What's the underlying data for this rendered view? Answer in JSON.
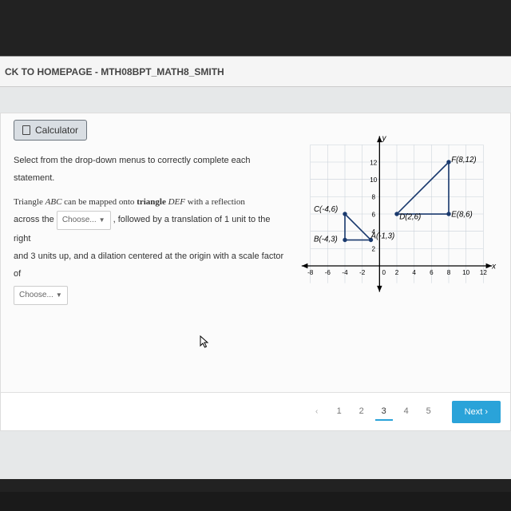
{
  "topbar": {
    "title": "CK TO HOMEPAGE - MTH08BPT_MATH8_SMITH"
  },
  "calculator": {
    "label": "Calculator"
  },
  "question": {
    "intro": "Select from the drop-down menus to correctly complete each statement.",
    "l1a": "Triangle ",
    "l1b": "ABC",
    "l1c": " can be mapped onto ",
    "l1d": "triangle ",
    "l1e": "DEF",
    "l1f": " with a reflection",
    "l2a": "across the ",
    "choose1": "Choose...",
    "l2b": " , followed by a translation of 1 unit to the right",
    "l3": "and 3 units up, and a dilation centered at the origin with a scale factor of",
    "choose2": "Choose..."
  },
  "chart_data": {
    "type": "scatter",
    "title": "",
    "xlabel": "x",
    "ylabel": "y",
    "xlim": [
      -8,
      12
    ],
    "ylim": [
      -2,
      14
    ],
    "grid": true,
    "points": [
      {
        "name": "A(-1,3)",
        "x": -1,
        "y": 3
      },
      {
        "name": "B(-4,3)",
        "x": -4,
        "y": 3
      },
      {
        "name": "C(-4,6)",
        "x": -4,
        "y": 6
      },
      {
        "name": "D(2,6)",
        "x": 2,
        "y": 6
      },
      {
        "name": "E(8,6)",
        "x": 8,
        "y": 6
      },
      {
        "name": "F(8,12)",
        "x": 8,
        "y": 12
      }
    ],
    "triangles": [
      {
        "name": "ABC",
        "verts": [
          "A",
          "B",
          "C"
        ]
      },
      {
        "name": "DEF",
        "verts": [
          "D",
          "E",
          "F"
        ]
      }
    ]
  },
  "pager": {
    "prev": "‹",
    "pages": [
      "1",
      "2",
      "3",
      "4",
      "5"
    ],
    "active": 2,
    "next": "Next ›"
  }
}
